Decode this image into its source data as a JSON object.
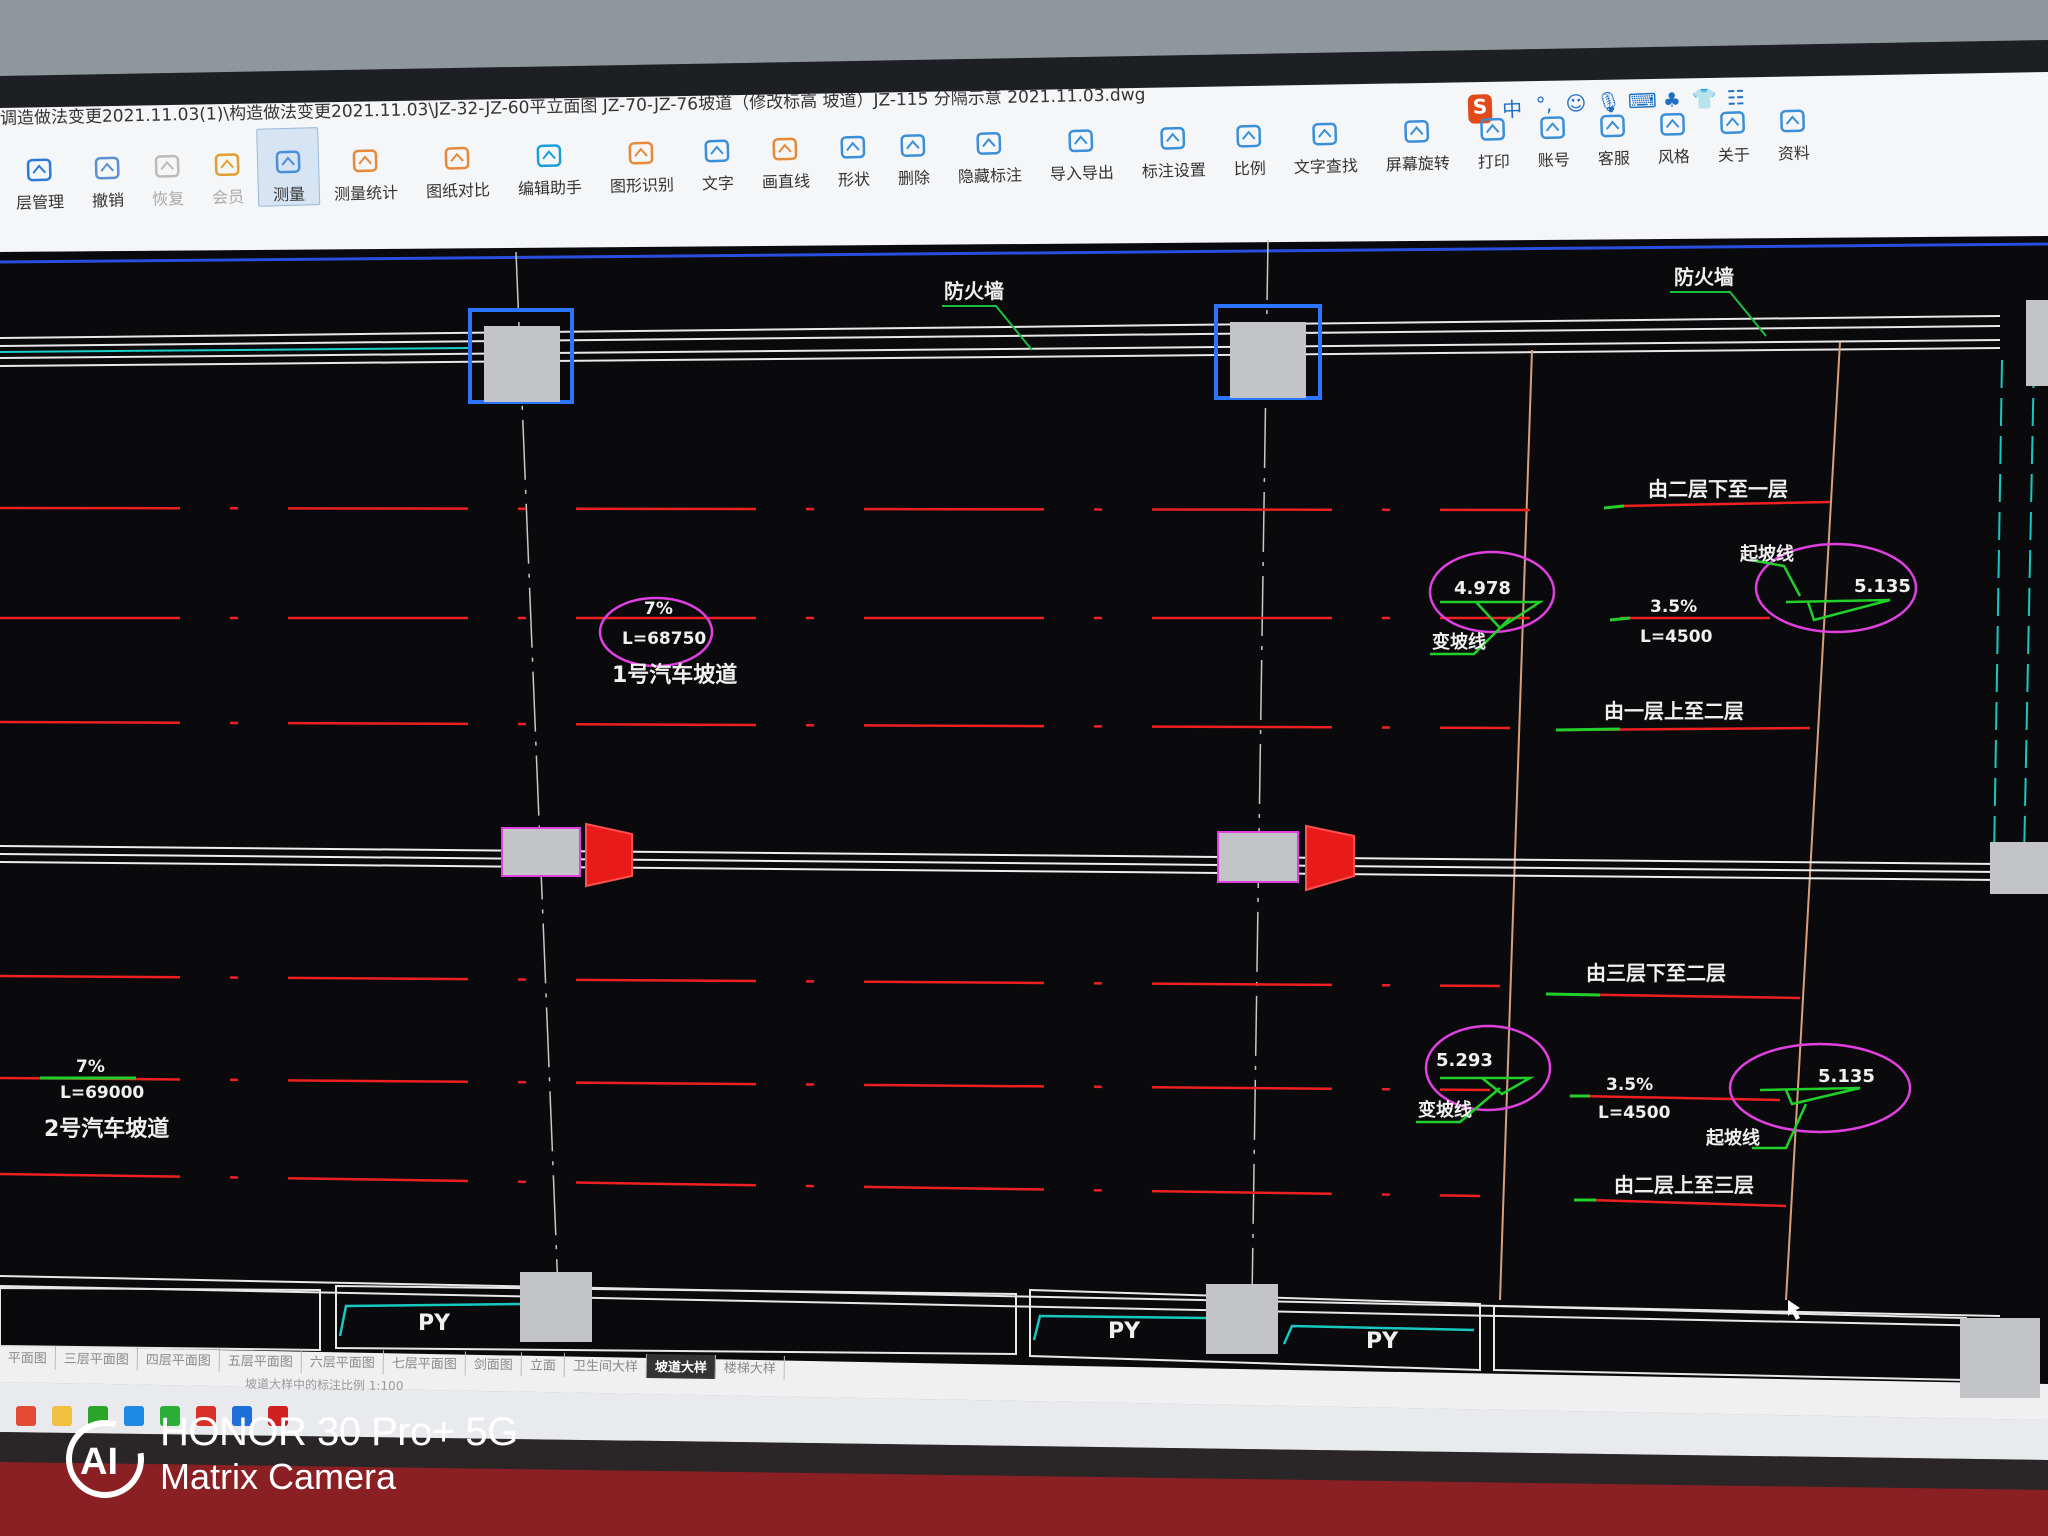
{
  "window": {
    "title": "调造做法变更2021.11.03(1)\\构造做法变更2021.11.03\\JZ-32-JZ-60平立面图 JZ-70-JZ-76坡道（修改标高 坡道）JZ-115 分隔示意 2021.11.03.dwg"
  },
  "ime": [
    "S",
    "中",
    "°,",
    "☺",
    "🎙",
    "⌨",
    "♣",
    "👕",
    "☷"
  ],
  "toolbar": [
    {
      "label": "层管理",
      "icon": "layers-icon",
      "color": "#2b7bd6"
    },
    {
      "label": "撤销",
      "icon": "undo-icon",
      "color": "#5a8fd0"
    },
    {
      "label": "恢复",
      "icon": "redo-icon",
      "color": "#bbbbbb",
      "dim": true
    },
    {
      "label": "会员",
      "icon": "vip-icon",
      "color": "#e0a030",
      "dim": true
    },
    {
      "label": "测量",
      "icon": "measure-icon",
      "color": "#4a90d9",
      "active": true
    },
    {
      "label": "测量统计",
      "icon": "measure-stats-icon",
      "color": "#e58a3a"
    },
    {
      "label": "图纸对比",
      "icon": "compare-icon",
      "color": "#e58a3a"
    },
    {
      "label": "编辑助手",
      "icon": "edit-helper-icon",
      "color": "#1aa0d8"
    },
    {
      "label": "图形识别",
      "icon": "shape-recognition-icon",
      "color": "#e58a3a"
    },
    {
      "label": "文字",
      "icon": "text-icon",
      "color": "#3a8fd8"
    },
    {
      "label": "画直线",
      "icon": "line-icon",
      "color": "#e58a3a"
    },
    {
      "label": "形状",
      "icon": "shape-icon",
      "color": "#3a8fd8"
    },
    {
      "label": "删除",
      "icon": "eraser-icon",
      "color": "#3a8fd8"
    },
    {
      "label": "隐藏标注",
      "icon": "hide-annotation-icon",
      "color": "#3a8fd8"
    },
    {
      "label": "导入导出",
      "icon": "import-export-icon",
      "color": "#3a8fd8"
    },
    {
      "label": "标注设置",
      "icon": "annotation-settings-icon",
      "color": "#3a8fd8"
    },
    {
      "label": "比例",
      "icon": "scale-icon",
      "color": "#3a8fd8"
    },
    {
      "label": "文字查找",
      "icon": "text-search-icon",
      "color": "#3a8fd8"
    },
    {
      "label": "屏幕旋转",
      "icon": "rotate-screen-icon",
      "color": "#3a8fd8"
    },
    {
      "label": "打印",
      "icon": "print-icon",
      "color": "#3a8fd8"
    },
    {
      "label": "账号",
      "icon": "account-icon",
      "color": "#3a8fd8"
    },
    {
      "label": "客服",
      "icon": "headset-icon",
      "color": "#3a8fd8"
    },
    {
      "label": "风格",
      "icon": "style-icon",
      "color": "#3a8fd8"
    },
    {
      "label": "关于",
      "icon": "info-icon",
      "color": "#3a8fd8"
    },
    {
      "label": "资料",
      "icon": "resources-icon",
      "color": "#3a8fd8"
    }
  ],
  "drawing": {
    "firewall_1": "防火墙",
    "firewall_2": "防火墙",
    "ramp1_slope": "7%",
    "ramp1_length": "L=68750",
    "ramp1_name": "1号汽车坡道",
    "ramp2_slope": "7%",
    "ramp2_length": "L=69000",
    "ramp2_name": "2号汽车坡道",
    "upper_down_2_1": "由二层下至一层",
    "upper_level_a": "4.978",
    "upper_change_a": "变坡线",
    "upper_slope": "3.5%",
    "upper_length": "L=4500",
    "upper_start": "起坡线",
    "upper_level_b": "5.135",
    "upper_up_1_2": "由一层上至二层",
    "lower_down_3_2": "由三层下至二层",
    "lower_level_a": "5.293",
    "lower_change_a": "变坡线",
    "lower_slope": "3.5%",
    "lower_length": "L=4500",
    "lower_start": "起坡线",
    "lower_level_b": "5.135",
    "lower_up_2_3": "由二层上至三层",
    "py_1": "PY",
    "py_2": "PY",
    "py_3": "PY"
  },
  "tabs": [
    {
      "label": "平面图"
    },
    {
      "label": "三层平面图"
    },
    {
      "label": "四层平面图"
    },
    {
      "label": "五层平面图"
    },
    {
      "label": "六层平面图"
    },
    {
      "label": "七层平面图"
    },
    {
      "label": "剑面图"
    },
    {
      "label": "立面"
    },
    {
      "label": "卫生间大样"
    },
    {
      "label": "坡道大样",
      "active": true
    },
    {
      "label": "楼梯大样"
    }
  ],
  "status": "坡道大样中的标注比例 1:100",
  "taskbar": [
    {
      "icon": "chrome-icon",
      "color": "#e24a33"
    },
    {
      "icon": "folder-icon",
      "color": "#f0c040"
    },
    {
      "icon": "browser-icon",
      "color": "#2aa52a"
    },
    {
      "icon": "document-icon",
      "color": "#1e88e5"
    },
    {
      "icon": "wechat-icon",
      "color": "#2aae35"
    },
    {
      "icon": "mail-icon",
      "color": "#d9302a"
    },
    {
      "icon": "cad-viewer-icon",
      "color": "#1e6fd9"
    },
    {
      "icon": "autocad-icon",
      "color": "#d12020"
    }
  ],
  "watermark": {
    "line1": "HONOR 30 Pro+ 5G",
    "line2": "Matrix Camera"
  }
}
